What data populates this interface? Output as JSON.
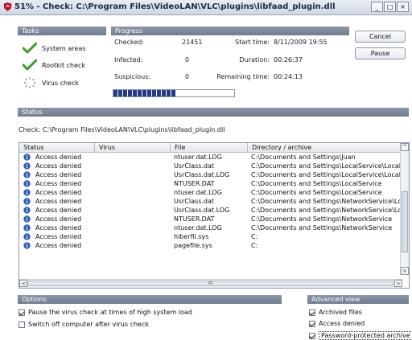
{
  "window": {
    "title": "51% - Check: C:\\Program Files\\VideoLAN\\VLC\\plugins\\libfaad_plugin.dll",
    "min": "_",
    "max": "□",
    "close": "×"
  },
  "tasks": {
    "header": "Tasks",
    "items": [
      {
        "label": "System areas",
        "state": "done"
      },
      {
        "label": "Rootkit check",
        "state": "done"
      },
      {
        "label": "Virus check",
        "state": "running"
      }
    ]
  },
  "progress": {
    "header": "Progress",
    "checked_label": "Checked:",
    "checked_value": "21451",
    "infected_label": "Infected:",
    "infected_value": "0",
    "suspicious_label": "Suspicious:",
    "suspicious_value": "0",
    "start_label": "Start time:",
    "start_value": "8/11/2009 19:55",
    "duration_label": "Duration:",
    "duration_value": "00:26:37",
    "remaining_label": "Remaining time:",
    "remaining_value": "00:24:13",
    "fraction": 0.51
  },
  "buttons": {
    "cancel": "Cancel",
    "pause": "Pause"
  },
  "status": {
    "header": "Status",
    "check_line": "Check: C:\\Program Files\\VideoLAN\\VLC\\plugins\\libfaad_plugin.dll",
    "columns": [
      "Status",
      "Virus",
      "File",
      "Directory / archive"
    ],
    "rows": [
      {
        "status": "Access denied",
        "virus": "",
        "file": "ntuser.dat.LOG",
        "dir": "C:\\Documents and Settings\\Juan"
      },
      {
        "status": "Access denied",
        "virus": "",
        "file": "UsrClass.dat",
        "dir": "C:\\Documents and Settings\\LocalService\\Local ..."
      },
      {
        "status": "Access denied",
        "virus": "",
        "file": "UsrClass.dat.LOG",
        "dir": "C:\\Documents and Settings\\LocalService\\Local ..."
      },
      {
        "status": "Access denied",
        "virus": "",
        "file": "NTUSER.DAT",
        "dir": "C:\\Documents and Settings\\LocalService"
      },
      {
        "status": "Access denied",
        "virus": "",
        "file": "ntuser.dat.LOG",
        "dir": "C:\\Documents and Settings\\LocalService"
      },
      {
        "status": "Access denied",
        "virus": "",
        "file": "UsrClass.dat",
        "dir": "C:\\Documents and Settings\\NetworkService\\Loc..."
      },
      {
        "status": "Access denied",
        "virus": "",
        "file": "UsrClass.dat.LOG",
        "dir": "C:\\Documents and Settings\\NetworkService\\Loc..."
      },
      {
        "status": "Access denied",
        "virus": "",
        "file": "NTUSER.DAT",
        "dir": "C:\\Documents and Settings\\NetworkService"
      },
      {
        "status": "Access denied",
        "virus": "",
        "file": "ntuser.dat.LOG",
        "dir": "C:\\Documents and Settings\\NetworkService"
      },
      {
        "status": "Access denied",
        "virus": "",
        "file": "hiberfil.sys",
        "dir": "C:"
      },
      {
        "status": "Access denied",
        "virus": "",
        "file": "pagefile.sys",
        "dir": "C:"
      }
    ],
    "scroll_grip": "III"
  },
  "options": {
    "header": "Options",
    "items": [
      {
        "label": "Pause the virus check at times of high system load",
        "checked": true
      },
      {
        "label": "Switch off computer after virus check",
        "checked": false
      }
    ]
  },
  "advanced": {
    "header": "Advanced view",
    "items": [
      {
        "label": "Archived files",
        "checked": true
      },
      {
        "label": "Access denied",
        "checked": true
      },
      {
        "label": "Password-protected archive",
        "checked": true
      }
    ]
  },
  "colors": {
    "section_header": "#7d8a9e",
    "progress_fill": "#213b88",
    "check_green": "#3a9a2a",
    "info_icon": "#2f5fb8"
  }
}
